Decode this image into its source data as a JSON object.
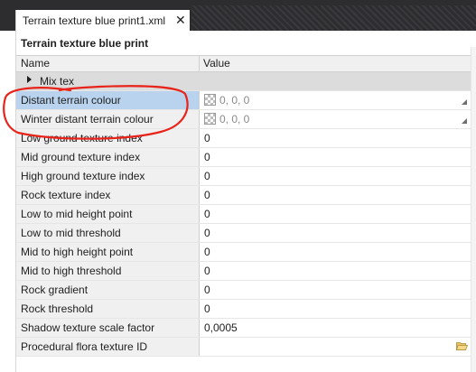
{
  "tab": {
    "title": "Terrain texture blue print1.xml",
    "close_glyph": "✕"
  },
  "panel": {
    "title": "Terrain texture blue print"
  },
  "grid": {
    "name_header": "Name",
    "value_header": "Value",
    "group": {
      "label": "Mix tex",
      "expanded": false
    },
    "rows": [
      {
        "name": "Distant terrain colour",
        "value": "0, 0, 0",
        "type": "color",
        "selected": true
      },
      {
        "name": "Winter distant terrain colour",
        "value": "0, 0, 0",
        "type": "color",
        "selected": false
      },
      {
        "name": "Low ground texture index",
        "value": "0",
        "type": "text"
      },
      {
        "name": "Mid ground texture index",
        "value": "0",
        "type": "text"
      },
      {
        "name": "High ground texture index",
        "value": "0",
        "type": "text"
      },
      {
        "name": "Rock texture index",
        "value": "0",
        "type": "text"
      },
      {
        "name": "Low to mid height point",
        "value": "0",
        "type": "text"
      },
      {
        "name": "Low to mid threshold",
        "value": "0",
        "type": "text"
      },
      {
        "name": "Mid to high height point",
        "value": "0",
        "type": "text"
      },
      {
        "name": "Mid to high threshold",
        "value": "0",
        "type": "text"
      },
      {
        "name": "Rock gradient",
        "value": "0",
        "type": "text"
      },
      {
        "name": "Rock threshold",
        "value": "0",
        "type": "text"
      },
      {
        "name": "Shadow texture scale factor",
        "value": "0,0005",
        "type": "text"
      },
      {
        "name": "Procedural flora texture ID",
        "value": "",
        "type": "file"
      }
    ]
  },
  "colors": {
    "annotation": "#e8231a",
    "selection": "#b9d3ee",
    "topbar": "#2d2d30"
  }
}
